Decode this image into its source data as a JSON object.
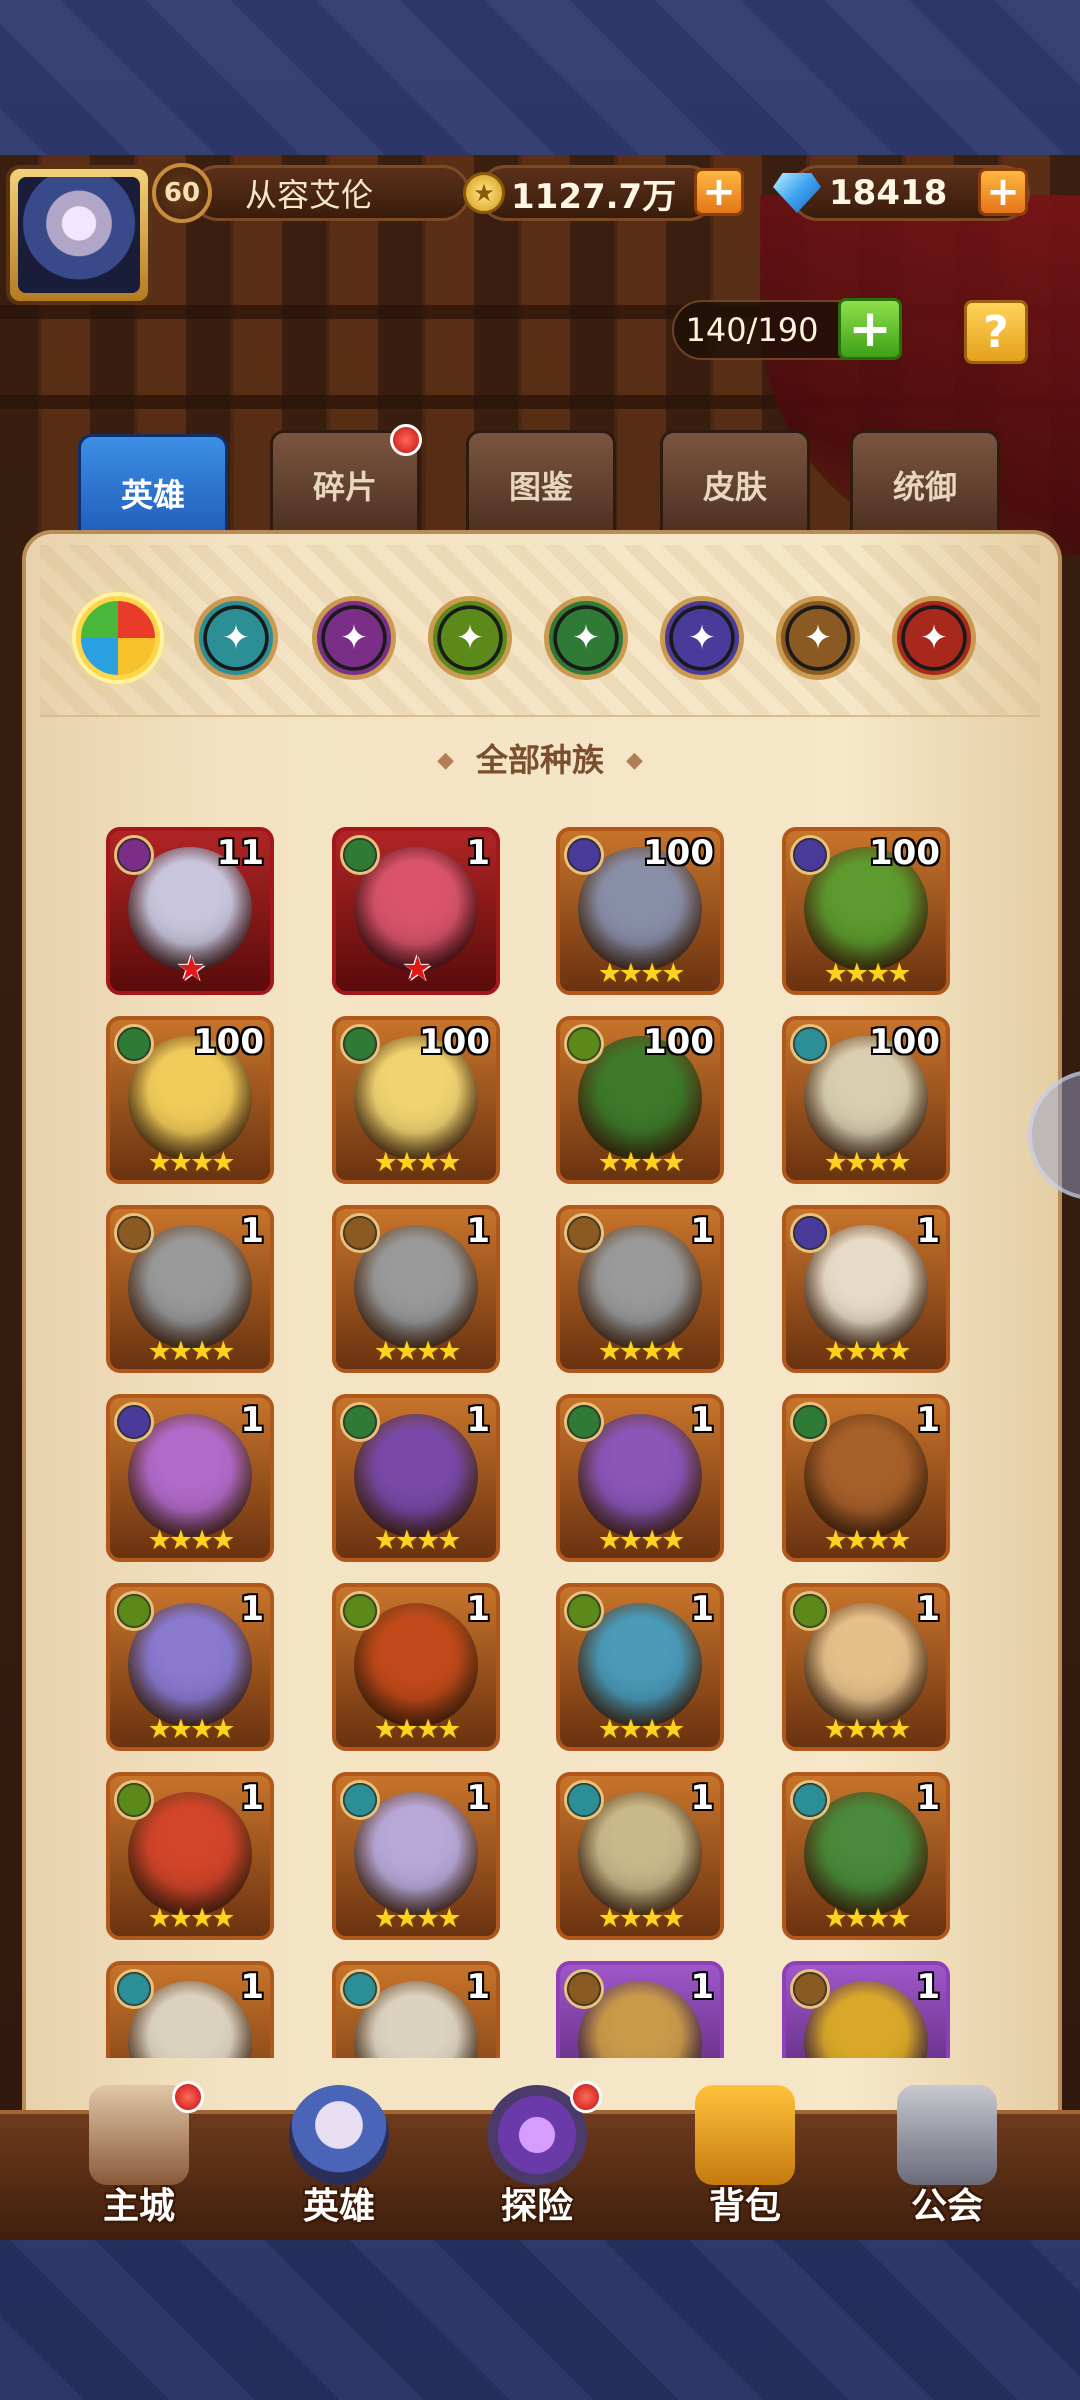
{
  "player": {
    "level": "60",
    "name": "从容艾伦",
    "gold": "1127.7万",
    "gems": "18418"
  },
  "hero_capacity": "140/190",
  "tabs": [
    {
      "label": "英雄",
      "active": true
    },
    {
      "label": "碎片",
      "badge": true
    },
    {
      "label": "图鉴"
    },
    {
      "label": "皮肤"
    },
    {
      "label": "统御"
    }
  ],
  "race_filters": [
    {
      "name": "all-races",
      "color": "#e05a2a"
    },
    {
      "name": "race-teal",
      "color": "#2d8f96"
    },
    {
      "name": "race-purple",
      "color": "#7a2e88"
    },
    {
      "name": "race-green",
      "color": "#5c8a1a"
    },
    {
      "name": "race-forest",
      "color": "#2f7a35"
    },
    {
      "name": "race-violet",
      "color": "#4a3a9a"
    },
    {
      "name": "race-bronze",
      "color": "#8a5a22"
    },
    {
      "name": "race-red",
      "color": "#a8281c"
    }
  ],
  "race_title": "全部种族",
  "heroes": [
    {
      "level": "11",
      "stars": "★",
      "star_type": "red",
      "frame": "red",
      "race": "#7a2e88",
      "face": "#c9c6dd"
    },
    {
      "level": "1",
      "stars": "★",
      "star_type": "red",
      "frame": "red",
      "race": "#2f7a35",
      "face": "#d9546a"
    },
    {
      "level": "100",
      "stars": "★★★★",
      "frame": "orange",
      "race": "#4a3a9a",
      "face": "#8a8fa8"
    },
    {
      "level": "100",
      "stars": "★★★★",
      "frame": "orange",
      "race": "#4a3a9a",
      "face": "#5e9a2e"
    },
    {
      "level": "100",
      "stars": "★★★★",
      "frame": "orange",
      "race": "#2f7a35",
      "face": "#f2cc5a"
    },
    {
      "level": "100",
      "stars": "★★★★",
      "frame": "orange",
      "race": "#2f7a35",
      "face": "#f0d470"
    },
    {
      "level": "100",
      "stars": "★★★★",
      "frame": "orange",
      "race": "#5c8a1a",
      "face": "#3e7a2a"
    },
    {
      "level": "100",
      "stars": "★★★★",
      "frame": "orange",
      "race": "#2d8f96",
      "face": "#d9cfb0"
    },
    {
      "level": "1",
      "stars": "★★★★",
      "frame": "orange",
      "race": "#8a5a22",
      "face": "#9a9a9a"
    },
    {
      "level": "1",
      "stars": "★★★★",
      "frame": "orange",
      "race": "#8a5a22",
      "face": "#9a9a9a"
    },
    {
      "level": "1",
      "stars": "★★★★",
      "frame": "orange",
      "race": "#8a5a22",
      "face": "#9a9a9a"
    },
    {
      "level": "1",
      "stars": "★★★★",
      "frame": "orange",
      "race": "#4a3a9a",
      "face": "#e8dcc8"
    },
    {
      "level": "1",
      "stars": "★★★★",
      "frame": "orange",
      "race": "#4a3a9a",
      "face": "#b36ac9"
    },
    {
      "level": "1",
      "stars": "★★★★",
      "frame": "orange",
      "race": "#2f7a35",
      "face": "#7a4aa8"
    },
    {
      "level": "1",
      "stars": "★★★★",
      "frame": "orange",
      "race": "#2f7a35",
      "face": "#8a56b8"
    },
    {
      "level": "1",
      "stars": "★★★★",
      "frame": "orange",
      "race": "#2f7a35",
      "face": "#a8602a"
    },
    {
      "level": "1",
      "stars": "★★★★",
      "frame": "orange",
      "race": "#5c8a1a",
      "face": "#8a7ad0"
    },
    {
      "level": "1",
      "stars": "★★★★",
      "frame": "orange",
      "race": "#5c8a1a",
      "face": "#c24a1a"
    },
    {
      "level": "1",
      "stars": "★★★★",
      "frame": "orange",
      "race": "#5c8a1a",
      "face": "#4a9ab8"
    },
    {
      "level": "1",
      "stars": "★★★★",
      "frame": "orange",
      "race": "#5c8a1a",
      "face": "#e6c08a"
    },
    {
      "level": "1",
      "stars": "★★★★",
      "frame": "orange",
      "race": "#5c8a1a",
      "face": "#d2452a"
    },
    {
      "level": "1",
      "stars": "★★★★",
      "frame": "orange",
      "race": "#2d8f96",
      "face": "#b8a8d8"
    },
    {
      "level": "1",
      "stars": "★★★★",
      "frame": "orange",
      "race": "#2d8f96",
      "face": "#c8b88a"
    },
    {
      "level": "1",
      "stars": "★★★★",
      "frame": "orange",
      "race": "#2d8f96",
      "face": "#4a8a3a"
    },
    {
      "level": "1",
      "stars": "",
      "frame": "orange",
      "race": "#2d8f96",
      "face": "#dcd2c0"
    },
    {
      "level": "1",
      "stars": "",
      "frame": "orange",
      "race": "#2d8f96",
      "face": "#dcd2c0"
    },
    {
      "level": "1",
      "stars": "",
      "frame": "purple",
      "race": "#8a5a22",
      "face": "#c99a4a"
    },
    {
      "level": "1",
      "stars": "",
      "frame": "purple",
      "race": "#8a5a22",
      "face": "#d9a82a"
    }
  ],
  "bottom_nav": [
    {
      "label": "主城",
      "icon": "castle-icon",
      "badge": true
    },
    {
      "label": "英雄",
      "icon": "hero-portrait-icon"
    },
    {
      "label": "探险",
      "icon": "portal-icon",
      "badge": true
    },
    {
      "label": "背包",
      "icon": "backpack-icon"
    },
    {
      "label": "公会",
      "icon": "guild-tower-icon"
    }
  ]
}
